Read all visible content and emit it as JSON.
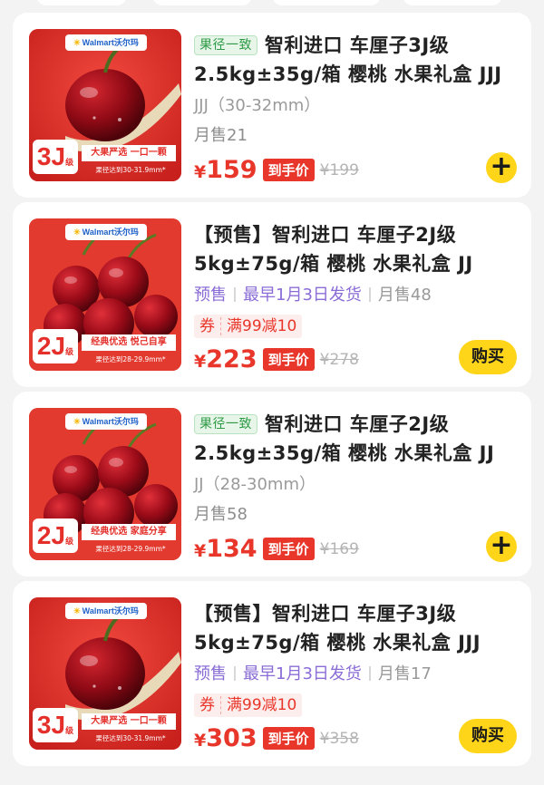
{
  "colors": {
    "price_red": "#e8362a",
    "accent_yellow": "#ffd51a",
    "presale_purple": "#8a6cd6",
    "tag_green": "#2e9a45"
  },
  "products": [
    {
      "tag": "果径一致",
      "title": "智利进口 车厘子3J级 2.5kg±35g/箱 樱桃 水果礼盒 JJJ",
      "spec": "JJJ（30-32mm）",
      "sold": "月售21",
      "price_symbol": "¥",
      "price": "159",
      "badge": "到手价",
      "original_price": "¥199",
      "action_icon": "plus-icon",
      "thumb": {
        "brand": "Walmart沃尔玛",
        "grade": "3J",
        "grade_suffix": "级",
        "slogan": "大果严选 一口一颗",
        "size_note": "果径达到30-31.9mm*"
      }
    },
    {
      "title": "【预售】智利进口 车厘子2J级 5kg±75g/箱 樱桃 水果礼盒 JJ",
      "presale": "预售",
      "ship": "最早1月3日发货",
      "sold": "月售48",
      "coupon_label": "券",
      "coupon_text": "满99减10",
      "price_symbol": "¥",
      "price": "223",
      "badge": "到手价",
      "original_price": "¥278",
      "buy_label": "购买",
      "thumb": {
        "brand": "Walmart沃尔玛",
        "grade": "2J",
        "grade_suffix": "级",
        "slogan": "经典优选 悦己自享",
        "size_note": "果径达到28-29.9mm*"
      }
    },
    {
      "tag": "果径一致",
      "title": "智利进口 车厘子2J级 2.5kg±35g/箱 樱桃 水果礼盒 JJ",
      "spec": "JJ（28-30mm）",
      "sold": "月售58",
      "price_symbol": "¥",
      "price": "134",
      "badge": "到手价",
      "original_price": "¥169",
      "action_icon": "plus-icon",
      "thumb": {
        "brand": "Walmart沃尔玛",
        "grade": "2J",
        "grade_suffix": "级",
        "slogan": "经典优选 家庭分享",
        "size_note": "果径达到28-29.9mm*"
      }
    },
    {
      "title": "【预售】智利进口 车厘子3J级 5kg±75g/箱 樱桃 水果礼盒 JJJ",
      "presale": "预售",
      "ship": "最早1月3日发货",
      "sold": "月售17",
      "coupon_label": "券",
      "coupon_text": "满99减10",
      "price_symbol": "¥",
      "price": "303",
      "badge": "到手价",
      "original_price": "¥358",
      "buy_label": "购买",
      "thumb": {
        "brand": "Walmart沃尔玛",
        "grade": "3J",
        "grade_suffix": "级",
        "slogan": "大果严选 一口一颗",
        "size_note": "果径达到30-31.9mm*"
      }
    }
  ]
}
